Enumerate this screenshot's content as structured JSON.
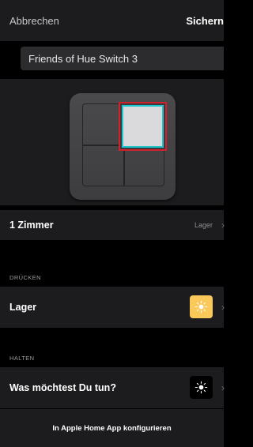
{
  "header": {
    "cancel_label": "Abbrechen",
    "save_label": "Sichern"
  },
  "device": {
    "name_value": "Friends of Hue Switch 3",
    "selected_button": "top-right"
  },
  "room": {
    "label": "1 Zimmer",
    "value": "Lager"
  },
  "press": {
    "section_label": "DRÜCKEN",
    "scene_label": "Lager",
    "scene_icon": "sun-icon",
    "scene_color": "#fbc95a"
  },
  "hold": {
    "section_label": "HALTEN",
    "action_label": "Was möchtest Du tun?",
    "action_icon": "sun-icon"
  },
  "footer": {
    "home_label": "In Apple Home App konfigurieren"
  },
  "colors": {
    "highlight_outer": "#d3202a",
    "highlight_inner": "#20c6cf"
  }
}
